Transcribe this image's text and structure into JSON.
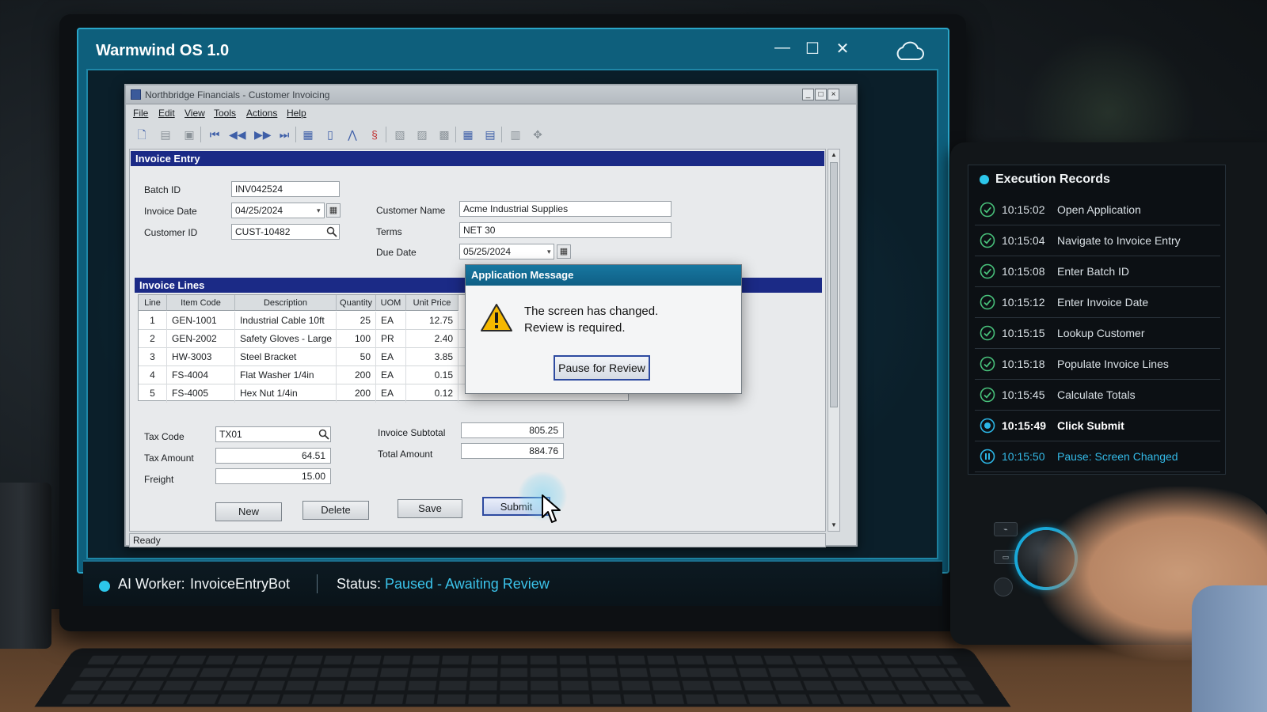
{
  "os": {
    "title": "Warmwind OS 1.0",
    "controls": {
      "minimize": "—",
      "maximize": "☐",
      "close": "✕"
    }
  },
  "app": {
    "title": "Northbridge Financials - Customer Invoicing",
    "menu": [
      "File",
      "Edit",
      "View",
      "Tools",
      "Actions",
      "Help"
    ],
    "toolbar_icons": [
      "new-doc-icon",
      "open-icon",
      "save-icon",
      "first-record-icon",
      "prev-record-icon",
      "next-record-icon",
      "last-record-icon",
      "report-icon",
      "page-icon",
      "edit-icon",
      "link-icon",
      "copy-icon",
      "paste-icon",
      "refresh-icon",
      "grid-icon",
      "list-icon",
      "options-icon",
      "help-icon"
    ],
    "invoice_entry": {
      "section_title": "Invoice Entry",
      "batch_id_label": "Batch ID",
      "batch_id": "INV042524",
      "invoice_date_label": "Invoice Date",
      "invoice_date": "04/25/2024",
      "customer_id_label": "Customer ID",
      "customer_id": "CUST-10482",
      "customer_name_label": "Customer Name",
      "customer_name": "Acme Industrial Supplies",
      "terms_label": "Terms",
      "terms": "NET 30",
      "due_date_label": "Due Date",
      "due_date": "05/25/2024"
    },
    "invoice_lines": {
      "section_title": "Invoice Lines",
      "columns": [
        "Line",
        "Item Code",
        "Description",
        "Quantity",
        "UOM",
        "Unit Price"
      ],
      "rows": [
        {
          "line": "1",
          "item_code": "GEN-1001",
          "description": "Industrial Cable 10ft",
          "quantity": "25",
          "uom": "EA",
          "unit_price": "12.75"
        },
        {
          "line": "2",
          "item_code": "GEN-2002",
          "description": "Safety Gloves - Large",
          "quantity": "100",
          "uom": "PR",
          "unit_price": "2.40"
        },
        {
          "line": "3",
          "item_code": "HW-3003",
          "description": "Steel Bracket",
          "quantity": "50",
          "uom": "EA",
          "unit_price": "3.85"
        },
        {
          "line": "4",
          "item_code": "FS-4004",
          "description": "Flat Washer 1/4in",
          "quantity": "200",
          "uom": "EA",
          "unit_price": "0.15"
        },
        {
          "line": "5",
          "item_code": "FS-4005",
          "description": "Hex Nut 1/4in",
          "quantity": "200",
          "uom": "EA",
          "unit_price": "0.12"
        }
      ]
    },
    "totals": {
      "tax_code_label": "Tax Code",
      "tax_code": "TX01",
      "tax_amount_label": "Tax Amount",
      "tax_amount": "64.51",
      "freight_label": "Freight",
      "freight": "15.00",
      "subtotal_label": "Invoice Subtotal",
      "subtotal": "805.25",
      "total_label": "Total Amount",
      "total": "884.76"
    },
    "buttons": {
      "new": "New",
      "delete": "Delete",
      "save": "Save",
      "submit": "Submit"
    },
    "status": "Ready"
  },
  "dialog": {
    "title": "Application Message",
    "line1": "The screen has changed.",
    "line2": "Review is required.",
    "button": "Pause for Review"
  },
  "taskbar": {
    "worker_label": "AI Worker:",
    "worker_name": "InvoiceEntryBot",
    "status_label": "Status:",
    "status_value": "Paused - Awaiting Review",
    "status_color": "#3bc3ea"
  },
  "execution": {
    "title": "Execution Records",
    "records": [
      {
        "time": "10:15:02",
        "step": "Open Application",
        "state": "done"
      },
      {
        "time": "10:15:04",
        "step": "Navigate to Invoice Entry",
        "state": "done"
      },
      {
        "time": "10:15:08",
        "step": "Enter Batch ID",
        "state": "done"
      },
      {
        "time": "10:15:12",
        "step": "Enter Invoice Date",
        "state": "done"
      },
      {
        "time": "10:15:15",
        "step": "Lookup Customer",
        "state": "done"
      },
      {
        "time": "10:15:18",
        "step": "Populate Invoice Lines",
        "state": "done"
      },
      {
        "time": "10:15:45",
        "step": "Calculate Totals",
        "state": "done"
      },
      {
        "time": "10:15:49",
        "step": "Click Submit",
        "state": "current"
      },
      {
        "time": "10:15:50",
        "step": "Pause: Screen Changed",
        "state": "paused"
      }
    ]
  },
  "colors": {
    "accent": "#2cc6ea",
    "os_frame": "#0e5f7c",
    "section_bar": "#1b2a86",
    "dialog_title": "#1777a0"
  }
}
